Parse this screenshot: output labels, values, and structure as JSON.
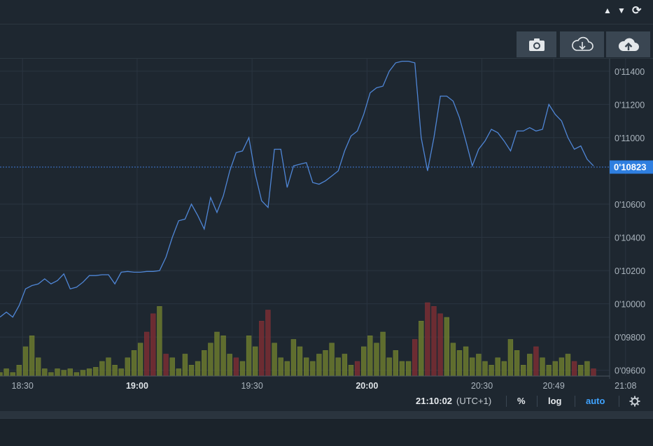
{
  "controls": {
    "up": "▲",
    "down": "▼",
    "refresh": "⟳"
  },
  "toolbar": {
    "camera_icon": "camera-icon",
    "download_icon": "cloud-download-icon",
    "upload_icon": "cloud-upload-icon"
  },
  "colors": {
    "line": "#4f86d6",
    "grid": "#2a3540",
    "vol_up": "#6b7a2e",
    "vol_down": "#7a2e33",
    "price_tag": "#2f7fe0"
  },
  "chart_data": {
    "type": "line",
    "y_ticks": [
      "0'11400",
      "0'11200",
      "0'11000",
      "0'10600",
      "0'10400",
      "0'10200",
      "0'10000",
      "0'09800",
      "0'09600"
    ],
    "y_tick_values": [
      11400,
      11200,
      11000,
      10600,
      10400,
      10200,
      10000,
      9800,
      9600
    ],
    "ylim": [
      9565,
      11475
    ],
    "x_ticks": [
      "18:30",
      "19:00",
      "19:30",
      "20:00",
      "20:30",
      "20:49",
      "21:08"
    ],
    "x_ticks_bold": [
      false,
      true,
      false,
      true,
      false,
      false,
      false
    ],
    "x_tick_frac": [
      0.0345,
      0.21,
      0.386,
      0.562,
      0.738,
      0.848,
      0.958
    ],
    "current_price": 10823,
    "current_price_label": "0'10823",
    "price": [
      9920,
      9950,
      9920,
      9990,
      10090,
      10110,
      10120,
      10150,
      10120,
      10140,
      10180,
      10090,
      10100,
      10130,
      10170,
      10170,
      10175,
      10175,
      10120,
      10190,
      10195,
      10190,
      10190,
      10195,
      10195,
      10200,
      10280,
      10400,
      10500,
      10510,
      10600,
      10530,
      10450,
      10640,
      10550,
      10650,
      10800,
      10910,
      10920,
      11000,
      10780,
      10620,
      10580,
      10930,
      10930,
      10700,
      10830,
      10840,
      10850,
      10730,
      10720,
      10740,
      10770,
      10800,
      10920,
      11010,
      11040,
      11140,
      11270,
      11300,
      11310,
      11400,
      11450,
      11460,
      11460,
      11450,
      11000,
      10800,
      11000,
      11250,
      11250,
      11220,
      11120,
      10980,
      10830,
      10930,
      10980,
      11050,
      11030,
      10980,
      10920,
      11040,
      11040,
      11060,
      11040,
      11050,
      11200,
      11140,
      11100,
      11000,
      10930,
      10950,
      10870,
      10830
    ],
    "volume": [
      5,
      10,
      5,
      15,
      40,
      55,
      25,
      10,
      5,
      10,
      8,
      10,
      5,
      8,
      10,
      12,
      20,
      25,
      15,
      10,
      25,
      35,
      45,
      60,
      85,
      95,
      30,
      25,
      10,
      30,
      15,
      20,
      35,
      45,
      60,
      55,
      30,
      25,
      20,
      55,
      40,
      75,
      90,
      45,
      25,
      20,
      50,
      40,
      25,
      20,
      30,
      35,
      45,
      25,
      30,
      15,
      20,
      40,
      55,
      45,
      60,
      25,
      35,
      20,
      20,
      50,
      75,
      100,
      95,
      85,
      80,
      45,
      35,
      40,
      25,
      30,
      20,
      15,
      25,
      20,
      50,
      35,
      15,
      30,
      40,
      25,
      15,
      20,
      25,
      30,
      20,
      15,
      20,
      10
    ],
    "volume_up": [
      true,
      true,
      true,
      true,
      true,
      true,
      true,
      true,
      true,
      true,
      true,
      true,
      true,
      true,
      true,
      true,
      true,
      true,
      true,
      true,
      true,
      true,
      true,
      false,
      false,
      true,
      false,
      true,
      true,
      true,
      true,
      true,
      true,
      true,
      true,
      true,
      true,
      false,
      true,
      true,
      true,
      false,
      false,
      true,
      true,
      true,
      true,
      true,
      true,
      true,
      true,
      true,
      true,
      true,
      true,
      true,
      false,
      true,
      true,
      true,
      true,
      true,
      true,
      true,
      true,
      false,
      true,
      false,
      false,
      false,
      true,
      true,
      true,
      true,
      true,
      true,
      true,
      true,
      true,
      true,
      true,
      true,
      true,
      true,
      false,
      true,
      true,
      true,
      true,
      true,
      false,
      true,
      true,
      false
    ]
  },
  "status": {
    "time": "21:10:02",
    "tz": "(UTC+1)",
    "percent": "%",
    "log": "log",
    "auto": "auto"
  }
}
